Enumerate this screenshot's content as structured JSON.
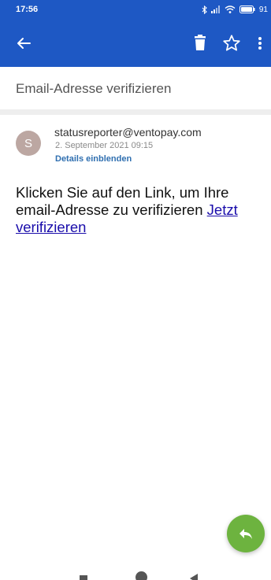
{
  "status_bar": {
    "time": "17:56",
    "battery": "91",
    "icons": [
      "bluetooth-icon",
      "signal-icon",
      "wifi-icon",
      "battery-icon"
    ]
  },
  "app_bar": {
    "color": "#1e58c4",
    "icons": [
      "back-arrow-icon",
      "trash-icon",
      "star-outline-icon",
      "more-vert-icon"
    ]
  },
  "email": {
    "subject": "Email-Adresse verifizieren",
    "avatar_letter": "S",
    "sender": "statusreporter@ventopay.com",
    "date": "2. September 2021 09:15",
    "details_label": "Details einblenden",
    "body_text": "Klicken Sie auf den Link, um Ihre email-Adresse zu verifizieren ",
    "link_text": "Jetzt verifizieren"
  },
  "fab": {
    "icon": "reply-icon",
    "color": "#6db33f"
  },
  "nav_bar": {
    "icons": [
      "recents-square-icon",
      "home-circle-icon",
      "back-triangle-icon"
    ]
  }
}
